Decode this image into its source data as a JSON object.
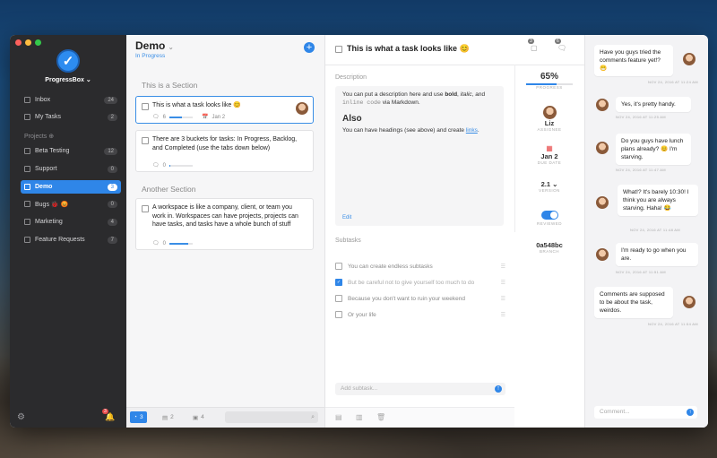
{
  "sidebar": {
    "workspace_name": "ProgressBox ⌄",
    "projects_header": "Projects ⊕",
    "items": [
      {
        "label": "Inbox",
        "badge": "24"
      },
      {
        "label": "My Tasks",
        "badge": "2"
      }
    ],
    "projects": [
      {
        "label": "Beta Testing",
        "badge": "12"
      },
      {
        "label": "Support",
        "badge": "0"
      },
      {
        "label": "Demo",
        "badge": "3"
      },
      {
        "label": "Bugs 🐞 😡",
        "badge": "0"
      },
      {
        "label": "Marketing",
        "badge": "4"
      },
      {
        "label": "Feature Requests",
        "badge": "7"
      }
    ],
    "notification_count": "3"
  },
  "tasklist": {
    "title": "Demo",
    "chevron": "⌄",
    "status": "In Progress",
    "add_label": "+",
    "sections": [
      {
        "title": "This is a Section"
      },
      {
        "title": "Another Section"
      }
    ],
    "tasks": [
      {
        "text": "This is what a task looks like 😊",
        "comments": "6",
        "progress": 0.55,
        "date": "Jan 2"
      },
      {
        "text": "There are 3 buckets for tasks: In Progress, Backlog, and Completed (use the tabs down below)",
        "comments": "0",
        "progress": 0.05
      },
      {
        "text": "A workspace is like a company, client, or team you work in. Workspaces can have projects, projects can have tasks, and tasks have a whole bunch of stuff",
        "comments": "0",
        "progress": 0.8
      }
    ],
    "tabs": [
      {
        "label": "3"
      },
      {
        "label": "2"
      },
      {
        "label": "4"
      }
    ]
  },
  "detail": {
    "title": "This is what a task looks like 😊",
    "header_badges": [
      "3",
      "6"
    ],
    "description_label": "Description",
    "desc_p1_a": "You can put a description here and use ",
    "desc_p1_bold": "bold",
    "desc_p1_b": ", ",
    "desc_p1_italic": "italic",
    "desc_p1_c": ", and ",
    "desc_p1_code": "inline code",
    "desc_p1_d": " via Markdown.",
    "desc_heading": "Also",
    "desc_p2_a": "You can have headings (see above) and create ",
    "desc_p2_link": "links",
    "desc_p2_b": ".",
    "edit_label": "Edit",
    "meta": {
      "progress": "65%",
      "progress_value": 0.65,
      "progress_caption": "PROGRESS",
      "assignee": "Liz",
      "assignee_caption": "ASSIGNEE",
      "due": "Jan 2",
      "due_caption": "DUE DATE",
      "version": "2.1 ⌄",
      "version_caption": "VERSION",
      "reviewed_caption": "REVIEWED",
      "branch": "0a548bc",
      "branch_caption": "BRANCH"
    },
    "subtasks_label": "Subtasks",
    "subtasks": [
      {
        "text": "You can create endless subtasks",
        "done": false
      },
      {
        "text": "But be careful not to give yourself too much to do",
        "done": true
      },
      {
        "text": "Because you don't want to ruin your weekend",
        "done": false
      },
      {
        "text": "Or your life",
        "done": false
      }
    ],
    "add_subtask_placeholder": "Add subtask..."
  },
  "comments": [
    {
      "text": "Have you guys tried the comments feature yet!? 😁",
      "time": "NOV 24, 2016 AT 11:24 AM",
      "side": "right"
    },
    {
      "text": "Yes, it's pretty handy.",
      "time": "NOV 24, 2016 AT 11:25 AM",
      "side": "left"
    },
    {
      "text": "Do you guys have lunch plans already? 😊 I'm starving.",
      "time": "NOV 24, 2016 AT 11:47 AM",
      "side": "left"
    },
    {
      "text": "What!? It's barely 10:30! I think you are always starving. Haha! 😂",
      "time": "NOV 24, 2016 AT 11:48 AM",
      "side": "right"
    },
    {
      "text": "I'm ready to go when you are.",
      "time": "NOV 24, 2016 AT 11:51 AM",
      "side": "left"
    },
    {
      "text": "Comments are supposed to be about the task, weirdos.",
      "time": "NOV 24, 2016 AT 11:54 AM",
      "side": "right"
    }
  ],
  "comment_placeholder": "Comment...",
  "colors": {
    "accent": "#2f86e8",
    "sidebar": "#2b2b2d"
  }
}
